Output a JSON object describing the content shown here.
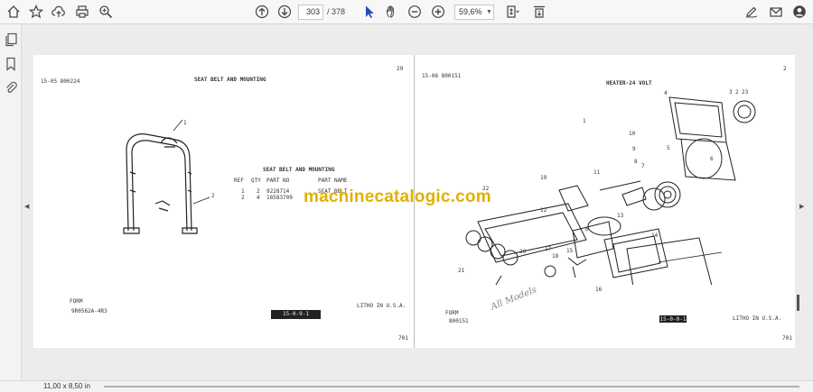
{
  "toolbar": {
    "page_current": "303",
    "page_total": "/ 378",
    "zoom": "59,6%",
    "icons": [
      "home-icon",
      "bookmark-star-icon",
      "cloud-upload-icon",
      "print-icon",
      "zoom-search-icon",
      "page-up-icon",
      "page-down-icon",
      "select-cursor-icon",
      "hand-pan-icon",
      "zoom-out-icon",
      "zoom-in-icon",
      "fit-page-icon",
      "scroll-mode-icon",
      "edit-sign-icon",
      "email-icon",
      "profile-icon"
    ]
  },
  "sidebar": {
    "icons": [
      "pages-icon",
      "bookmarks-icon",
      "attachments-icon"
    ]
  },
  "left_page": {
    "page_num": "29",
    "code": "15-05 800224",
    "title": "SEAT BELT AND MOUNTING",
    "table_title": "SEAT BELT AND MOUNTING",
    "headers": [
      "REF",
      "QTY",
      "PART NO",
      "PART NAME"
    ],
    "rows": [
      {
        "ref": "1",
        "qty": "2",
        "part_no": "9228714",
        "part_name": "SEAT BELT"
      },
      {
        "ref": "2",
        "qty": "4",
        "part_no": "18583709",
        "part_name": ""
      }
    ],
    "callouts": [
      "1",
      "2"
    ],
    "form_label": "FORM",
    "form_code": "9R0562A-4R3",
    "tape_label": "15-0-9-1",
    "litho": "LITHO IN U.S.A.",
    "footer_num": "701"
  },
  "right_page": {
    "page_num": "2",
    "code": "15-06 800151",
    "title": "HEATER-24 VOLT",
    "callouts": [
      "1",
      "4",
      "3",
      "2",
      "23",
      "5",
      "6",
      "8",
      "7",
      "9",
      "10",
      "11",
      "12",
      "13",
      "14",
      "15",
      "16",
      "17",
      "18",
      "19",
      "20",
      "21",
      "22",
      "6"
    ],
    "form_label": "FORM",
    "form_code": "800151",
    "tape_label": "15-0-0-1",
    "litho": "LITHO IN U.S.A.",
    "footer_num": "701",
    "handwriting": "All Models"
  },
  "watermark": "machinecatalogic.com",
  "status": {
    "page_size": "11,00 x 8,50 in"
  }
}
